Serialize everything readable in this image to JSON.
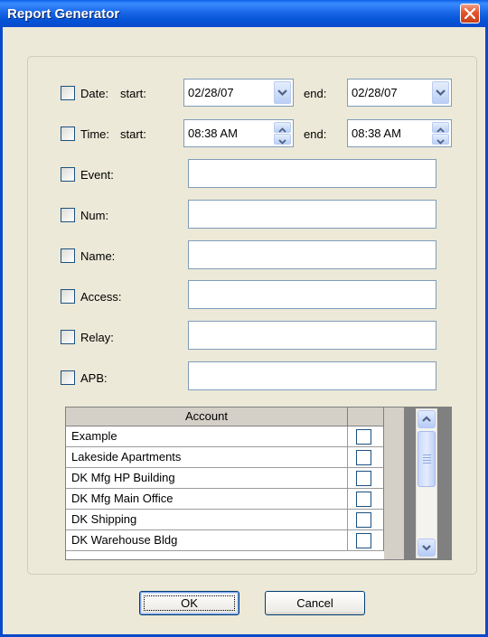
{
  "window": {
    "title": "Report Generator"
  },
  "filters": {
    "date": {
      "label": "Date:",
      "start_label": "start:",
      "start_value": "02/28/07",
      "end_label": "end:",
      "end_value": "02/28/07"
    },
    "time": {
      "label": "Time:",
      "start_label": "start:",
      "start_value": "08:38 AM",
      "end_label": "end:",
      "end_value": "08:38 AM"
    },
    "event": {
      "label": "Event:",
      "value": ""
    },
    "num": {
      "label": "Num:",
      "value": ""
    },
    "name": {
      "label": "Name:",
      "value": ""
    },
    "access": {
      "label": "Access:",
      "value": ""
    },
    "relay": {
      "label": "Relay:",
      "value": ""
    },
    "apb": {
      "label": "APB:",
      "value": ""
    }
  },
  "accounts": {
    "header": "Account",
    "rows": [
      {
        "name": "Example",
        "checked": false
      },
      {
        "name": "Lakeside Apartments",
        "checked": false
      },
      {
        "name": "DK Mfg HP Building",
        "checked": false
      },
      {
        "name": "DK Mfg Main Office",
        "checked": false
      },
      {
        "name": "DK Shipping",
        "checked": false
      },
      {
        "name": "DK Warehouse Bldg",
        "checked": false
      }
    ]
  },
  "buttons": {
    "ok": "OK",
    "cancel": "Cancel"
  },
  "icons": {
    "close": "close-icon",
    "dropdown": "chevron-down-icon",
    "spin_up": "chevron-up-icon",
    "spin_down": "chevron-down-icon",
    "scroll_up": "chevron-up-icon",
    "scroll_down": "chevron-down-icon"
  },
  "colors": {
    "titlebar": "#0A5FE6",
    "close": "#E2552C",
    "dialog_bg": "#ECE9D8"
  }
}
